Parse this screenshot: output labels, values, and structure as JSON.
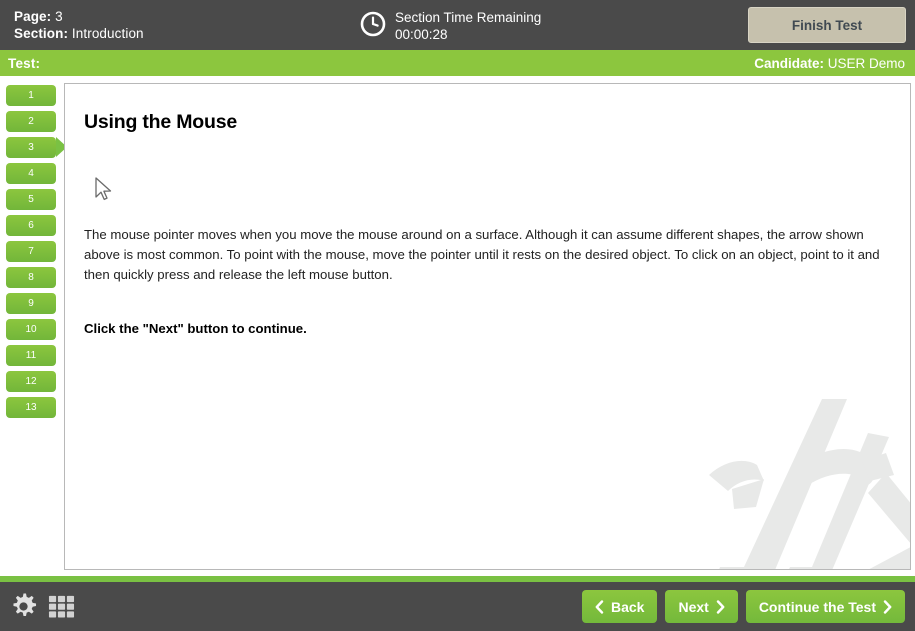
{
  "header": {
    "page_label": "Page:",
    "page_value": "3",
    "section_label": "Section:",
    "section_value": "Introduction",
    "clock_icon": "clock-icon",
    "timer_label": "Section Time Remaining",
    "timer_value": "00:00:28",
    "finish_test_label": "Finish Test"
  },
  "subbar": {
    "test_label": "Test:",
    "candidate_key": "Candidate",
    "candidate_sep": ": ",
    "candidate_value": "USER Demo"
  },
  "sidebar": {
    "active_index": 2,
    "items": [
      {
        "label": "1"
      },
      {
        "label": "2"
      },
      {
        "label": "3"
      },
      {
        "label": "4"
      },
      {
        "label": "5"
      },
      {
        "label": "6"
      },
      {
        "label": "7"
      },
      {
        "label": "8"
      },
      {
        "label": "9"
      },
      {
        "label": "10"
      },
      {
        "label": "11"
      },
      {
        "label": "12"
      },
      {
        "label": "13"
      }
    ]
  },
  "content": {
    "title": "Using the Mouse",
    "cursor_icon": "mouse-pointer-icon",
    "body": "The mouse pointer moves when you move the mouse around on a surface. Although it can assume different shapes, the arrow shown above is most common. To point with the mouse, move the pointer until it rests on the desired object. To click on an object, point to it and then quickly press and release the left mouse button.",
    "instruction": "Click the \"Next\" button to continue.",
    "watermark_icon": "brand-watermark-logo"
  },
  "footer": {
    "settings_icon": "gear-icon",
    "grid_icon": "grid-menu-icon",
    "back_label": "Back",
    "next_label": "Next",
    "continue_label": "Continue the Test",
    "chevron_left_icon": "chevron-left-icon",
    "chevron_right_icon": "chevron-right-icon"
  },
  "colors": {
    "brand_green": "#8cc63e",
    "dark_bar": "#4a4a4a",
    "finish_button": "#c6c1ad",
    "panel_border": "#b8b8b8",
    "watermark_gray": "#e8e9e8"
  }
}
